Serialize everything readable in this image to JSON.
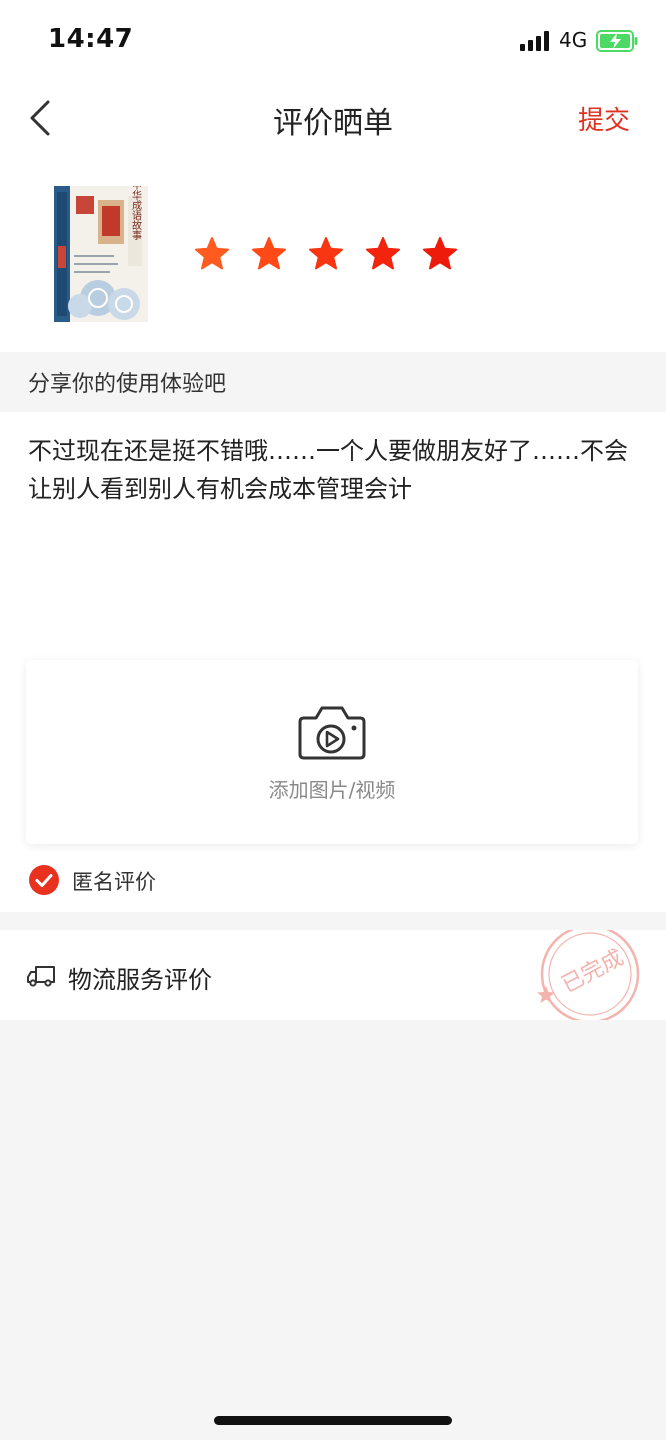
{
  "status_bar": {
    "time": "14:47",
    "network": "4G",
    "signal_icon": "signal-bars-icon",
    "battery_icon": "battery-charging-icon"
  },
  "nav": {
    "back_icon": "chevron-left-icon",
    "title": "评价晒单",
    "submit_label": "提交"
  },
  "product": {
    "cover_title": "中华成语故事",
    "rating": 5,
    "rating_max": 5,
    "star_colors": [
      "#ff5a1f",
      "#ff4a18",
      "#f83612",
      "#f2240e",
      "#ee1a0a"
    ]
  },
  "review": {
    "section_header": "分享你的使用体验吧",
    "text": "不过现在还是挺不错哦……一个人要做朋友好了……不会让别人看到别人有机会成本管理会计",
    "media_label": "添加图片/视频",
    "camera_icon": "camera-video-icon"
  },
  "anonymous": {
    "label": "匿名评价",
    "checked": true
  },
  "logistics": {
    "label": "物流服务评价",
    "truck_icon": "truck-icon",
    "stamp_text": "已完成"
  },
  "colors": {
    "accent": "#e0301e",
    "background": "#f5f5f5",
    "card": "#ffffff"
  }
}
